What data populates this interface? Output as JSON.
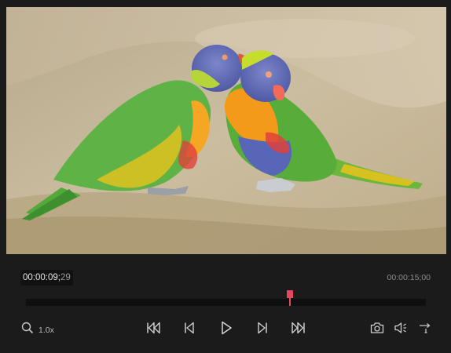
{
  "player": {
    "current_time": "00:00:09;",
    "current_frames": "29",
    "total_time": "00:00:15;00",
    "progress_fraction": 0.66,
    "zoom_level": "1.0x",
    "accent_color": "#e5485c"
  },
  "controls": {
    "zoom": {
      "icon": "search-icon"
    },
    "skip_start": {
      "icon": "skip-to-start-icon"
    },
    "prev_frame": {
      "icon": "previous-frame-icon"
    },
    "play": {
      "icon": "play-icon"
    },
    "next_frame": {
      "icon": "next-frame-icon"
    },
    "skip_end": {
      "icon": "skip-to-end-icon"
    },
    "snapshot": {
      "icon": "camera-icon"
    },
    "volume": {
      "icon": "speaker-icon"
    },
    "loop": {
      "icon": "loop-icon"
    }
  }
}
